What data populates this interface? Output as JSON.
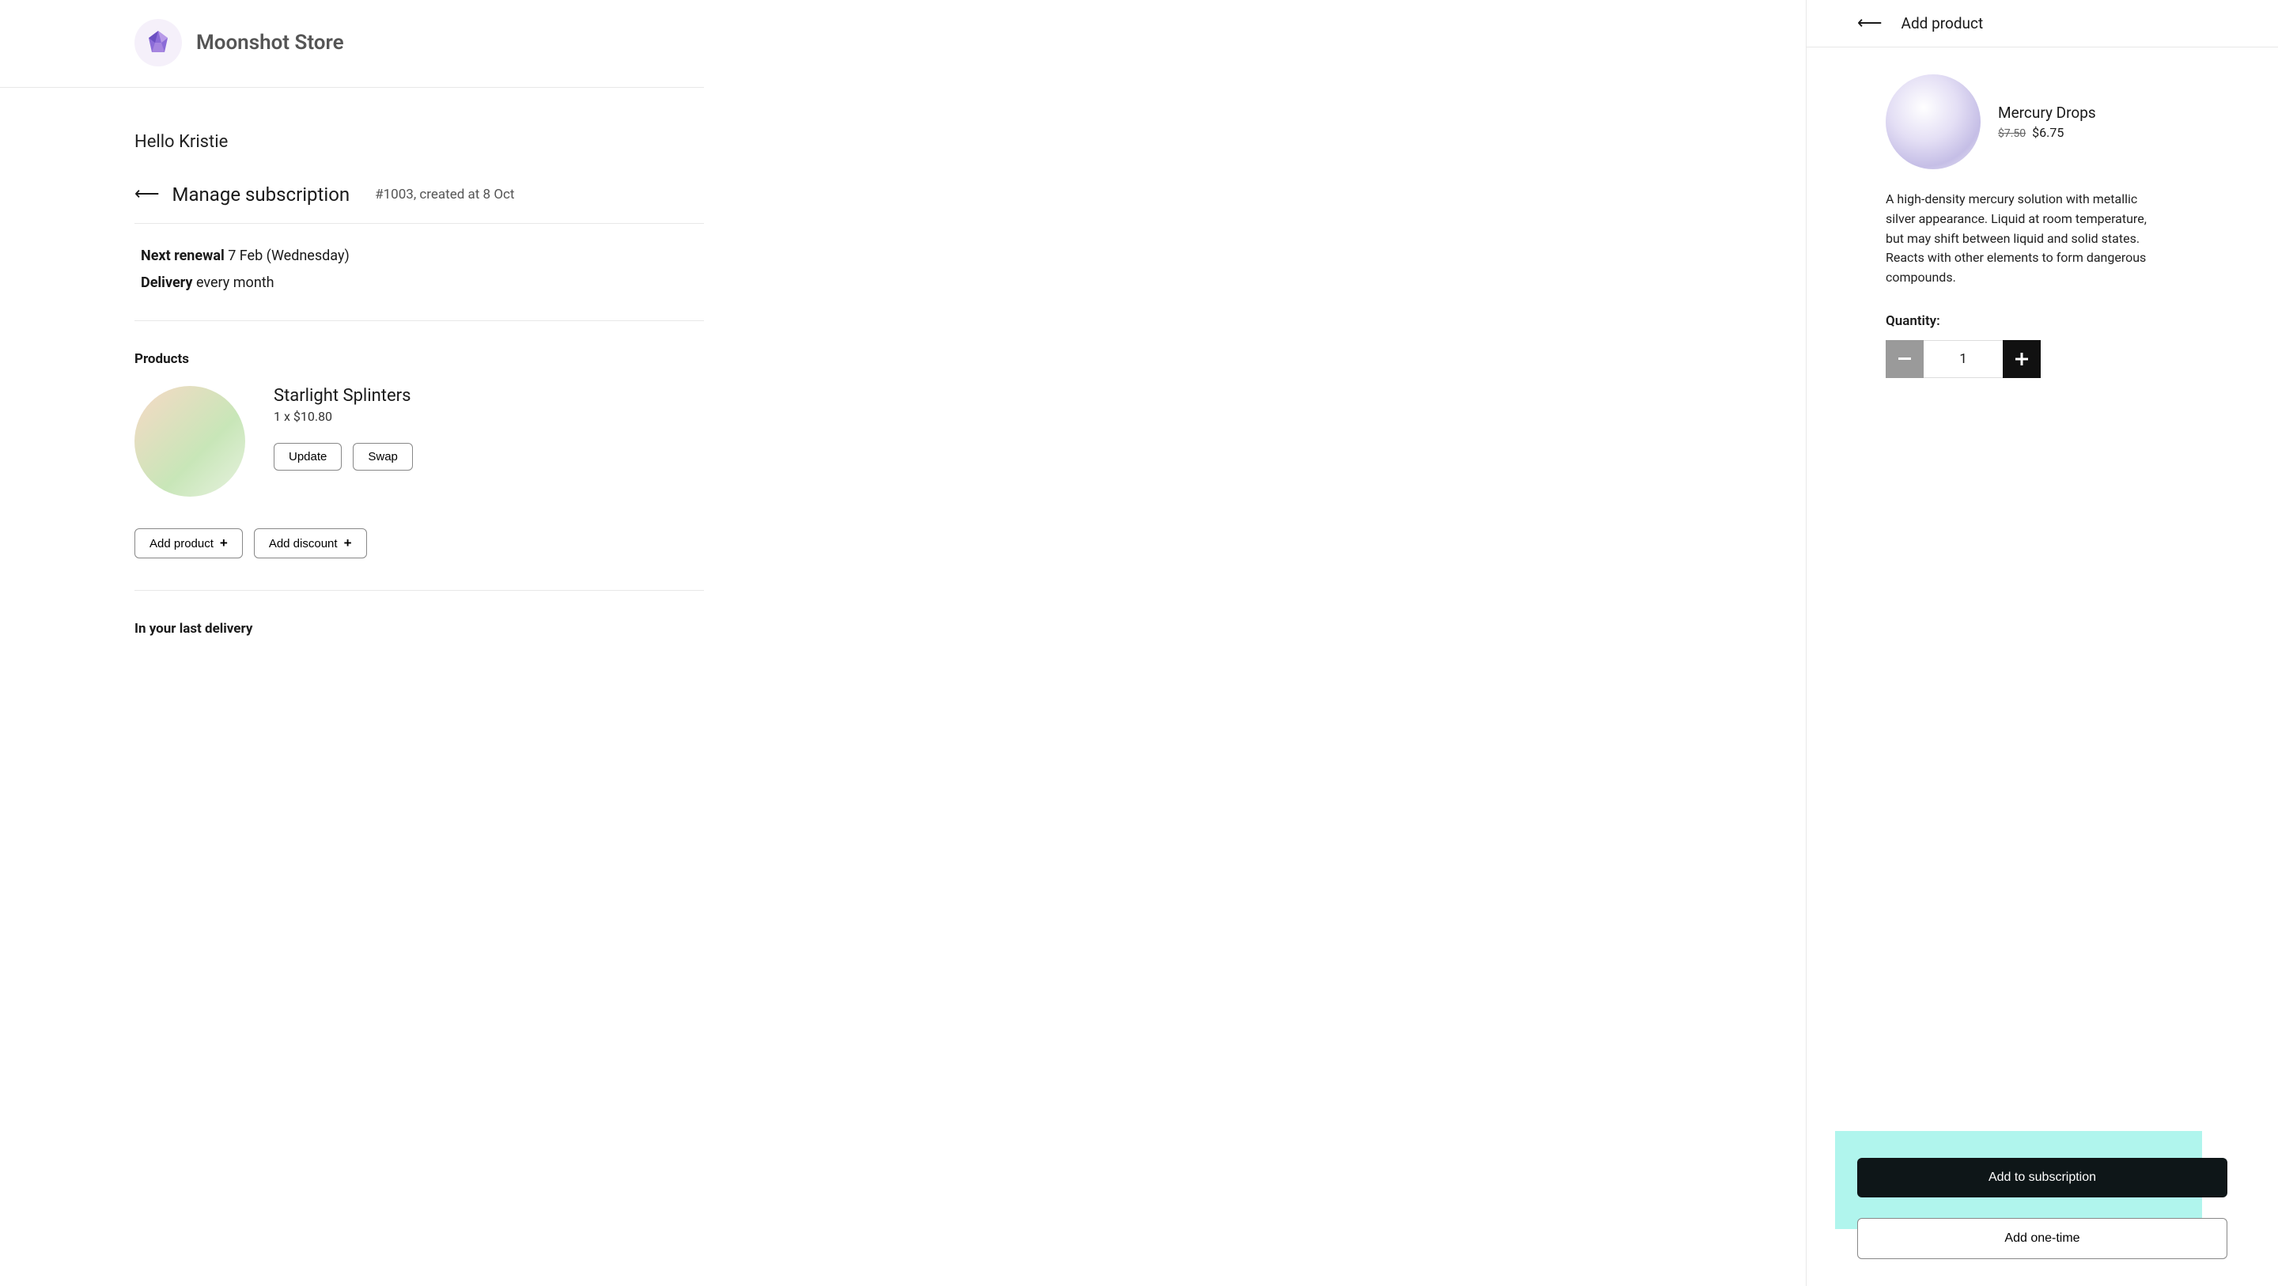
{
  "store": {
    "name": "Moonshot Store"
  },
  "greeting": "Hello Kristie",
  "page": {
    "title": "Manage subscription",
    "meta": "#1003, created at 8 Oct"
  },
  "renewal": {
    "next_label": "Next renewal",
    "next_value": "7 Feb (Wednesday)",
    "delivery_label": "Delivery",
    "delivery_value": "every month"
  },
  "products": {
    "heading": "Products",
    "items": [
      {
        "name": "Starlight Splinters",
        "price_line": "1 x $10.80",
        "update_label": "Update",
        "swap_label": "Swap"
      }
    ]
  },
  "actions": {
    "add_product": "Add product",
    "add_discount": "Add discount"
  },
  "last_delivery_heading": "In your last delivery",
  "side": {
    "title": "Add product",
    "product": {
      "name": "Mercury Drops",
      "price_old": "$7.50",
      "price_new": "$6.75",
      "description": "A high-density mercury solution with metallic silver appearance. Liquid at room temperature, but may shift between liquid and solid states. Reacts with other elements to form dangerous compounds."
    },
    "quantity_label": "Quantity:",
    "quantity_value": "1",
    "add_sub_label": "Add to subscription",
    "add_once_label": "Add one-time"
  }
}
